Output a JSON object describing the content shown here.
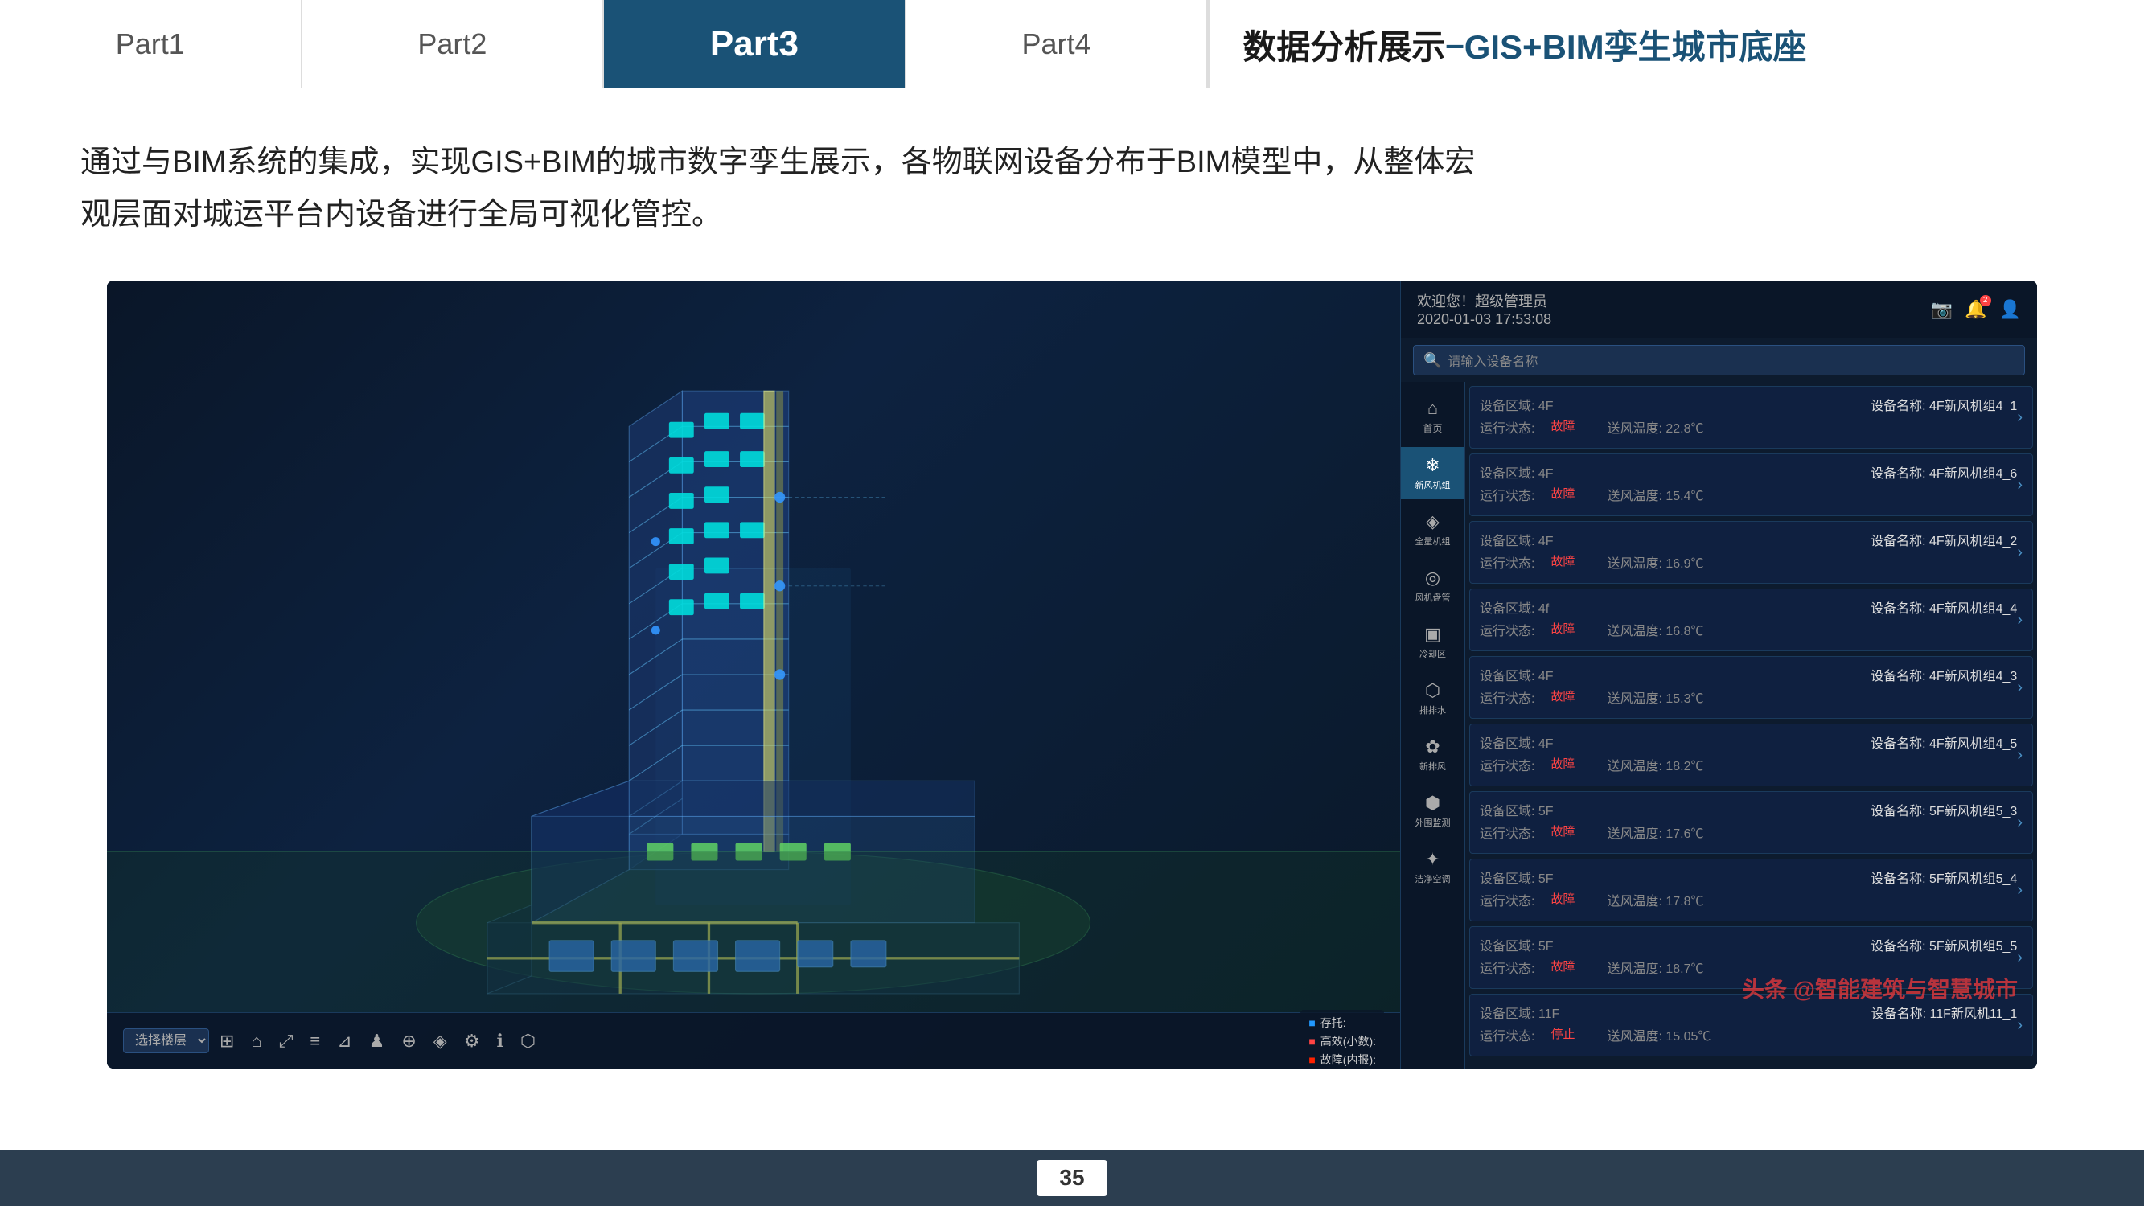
{
  "nav": {
    "items": [
      {
        "id": "part1",
        "label": "Part1",
        "active": false
      },
      {
        "id": "part2",
        "label": "Part2",
        "active": false
      },
      {
        "id": "part3",
        "label": "Part3",
        "active": true
      },
      {
        "id": "part4",
        "label": "Part4",
        "active": false
      }
    ],
    "title_prefix": "数据分析展示",
    "title_dash": "–",
    "title_suffix": "GIS+BIM孪生城市底座"
  },
  "description": {
    "line1": "通过与BIM系统的集成，实现GIS+BIM的城市数字孪生展示，各物联网设备分布于BIM模型中，从整体宏",
    "line2": "观层面对城运平台内设备进行全局可视化管控。"
  },
  "app": {
    "welcome": "欢迎您！超级管理员",
    "datetime": "2020-01-03 17:53:08",
    "search_placeholder": "请输入设备名称"
  },
  "side_nav": [
    {
      "id": "home",
      "icon": "⌂",
      "label": "首页",
      "active": false
    },
    {
      "id": "fankong",
      "icon": "❄",
      "label": "新风机组",
      "active": true
    },
    {
      "id": "quanzu",
      "icon": "◈",
      "label": "全量机组",
      "active": false
    },
    {
      "id": "fengji",
      "icon": "◎",
      "label": "风机盘管",
      "active": false
    },
    {
      "id": "lengque",
      "icon": "▣",
      "label": "冷却区",
      "active": false
    },
    {
      "id": "paishui",
      "icon": "⬡",
      "label": "排排水",
      "active": false
    },
    {
      "id": "xinfeng",
      "icon": "✿",
      "label": "新排风",
      "active": false
    },
    {
      "id": "waiwei",
      "icon": "⬢",
      "label": "外围监测",
      "active": false
    },
    {
      "id": "kongtiao",
      "icon": "✦",
      "label": "洁净空调",
      "active": false
    }
  ],
  "devices": [
    {
      "area": "设备区域: 4F",
      "name": "设备名称: 4F新风机组4_1",
      "temp_label": "送风温度: 22.8℃",
      "status_label": "运行状态:",
      "status": "故障",
      "status_type": "error"
    },
    {
      "area": "设备区域: 4F",
      "name": "设备名称: 4F新风机组4_6",
      "temp_label": "送风温度: 15.4℃",
      "status_label": "运行状态:",
      "status": "故障",
      "status_type": "error"
    },
    {
      "area": "设备区域: 4F",
      "name": "设备名称: 4F新风机组4_2",
      "temp_label": "送风温度: 16.9℃",
      "status_label": "运行状态:",
      "status": "故障",
      "status_type": "error"
    },
    {
      "area": "设备区域: 4f",
      "name": "设备名称: 4F新风机组4_4",
      "temp_label": "送风温度: 16.8℃",
      "status_label": "运行状态:",
      "status": "故障",
      "status_type": "error"
    },
    {
      "area": "设备区域: 4F",
      "name": "设备名称: 4F新风机组4_3",
      "temp_label": "送风温度: 15.3℃",
      "status_label": "运行状态:",
      "status": "故障",
      "status_type": "error"
    },
    {
      "area": "设备区域: 4F",
      "name": "设备名称: 4F新风机组4_5",
      "temp_label": "送风温度: 18.2℃",
      "status_label": "运行状态:",
      "status": "故障",
      "status_type": "error"
    },
    {
      "area": "设备区域: 5F",
      "name": "设备名称: 5F新风机组5_3",
      "temp_label": "送风温度: 17.6℃",
      "status_label": "运行状态:",
      "status": "故障",
      "status_type": "error"
    },
    {
      "area": "设备区域: 5F",
      "name": "设备名称: 5F新风机组5_4",
      "temp_label": "送风温度: 17.8℃",
      "status_label": "运行状态:",
      "status": "故障",
      "status_type": "error"
    },
    {
      "area": "设备区域: 5F",
      "name": "设备名称: 5F新风机组5_5",
      "temp_label": "送风温度: 18.7℃",
      "status_label": "运行状态:",
      "status": "故障",
      "status_type": "error"
    },
    {
      "area": "设备区域: 11F",
      "name": "设备名称: 11F新风机11_1",
      "temp_label": "送风温度: 15.05℃",
      "status_label": "运行状态:",
      "status": "停止",
      "status_type": "error"
    }
  ],
  "legend": {
    "items": [
      {
        "label": "存托:",
        "color": "#2299ff"
      },
      {
        "label": "高效(小数):",
        "color": "#ff4444"
      },
      {
        "label": "故障(内报):",
        "color": "#ff2200"
      }
    ]
  },
  "toolbar": {
    "select_label": "选择楼层",
    "icons": [
      "⊞",
      "⌂",
      "⤢",
      "≡",
      "⊿",
      "♟",
      "⊕",
      "◈",
      "⚙",
      "ℹ",
      "⬡"
    ]
  },
  "watermark": {
    "text": "头条 @智能建筑与智慧城市"
  },
  "page": {
    "number": "35"
  }
}
